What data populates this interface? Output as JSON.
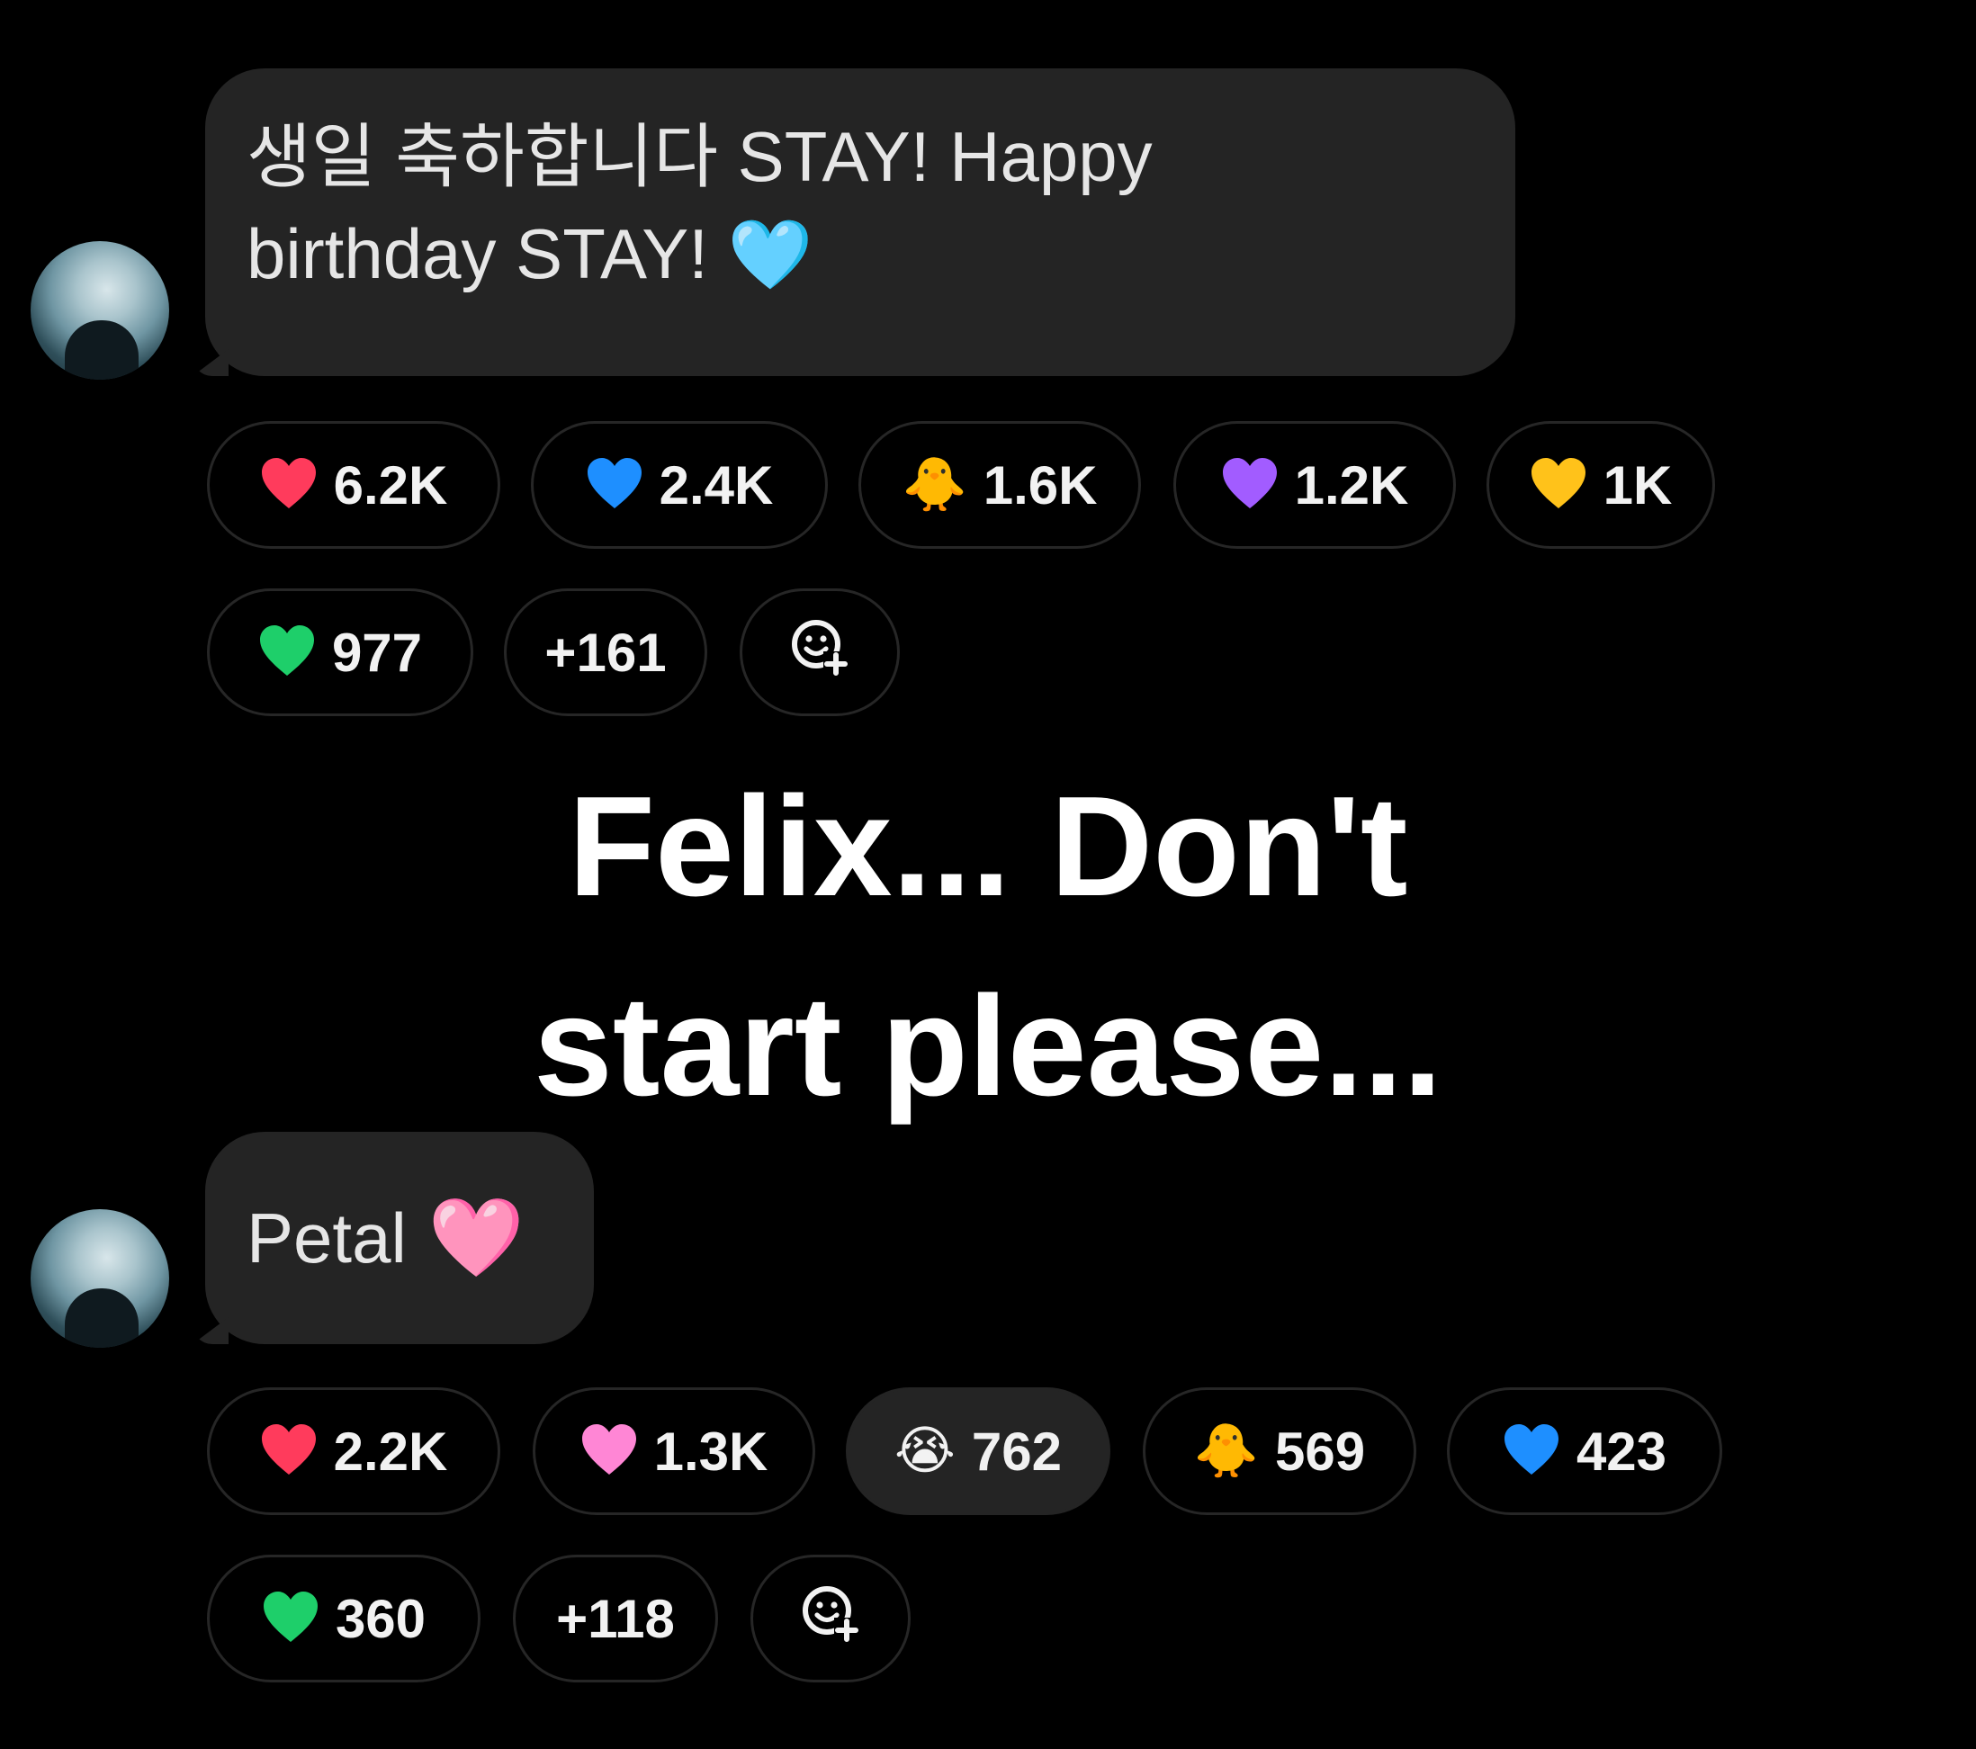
{
  "messages": [
    {
      "line1": "생일 축하합니다 STAY! Happy",
      "line2": "birthday STAY!",
      "heart_emoji": "🩵",
      "reactions": [
        {
          "icon": "red-heart-icon",
          "color": "#ff3b5c",
          "count": "6.2K"
        },
        {
          "icon": "blue-heart-icon",
          "color": "#1e8fff",
          "count": "2.4K"
        },
        {
          "icon": "chick-icon",
          "emoji": "🐥",
          "count": "1.6K"
        },
        {
          "icon": "purple-heart-icon",
          "color": "#a25cff",
          "count": "1.2K"
        },
        {
          "icon": "yellow-heart-icon",
          "color": "#ffc21a",
          "count": "1K"
        },
        {
          "icon": "green-heart-icon",
          "color": "#1ecf6a",
          "count": "977"
        },
        {
          "more": "+161"
        }
      ]
    },
    {
      "text": "Petal",
      "heart_emoji": "🩷",
      "reactions": [
        {
          "icon": "red-heart-icon",
          "color": "#ff3b5c",
          "count": "2.2K"
        },
        {
          "icon": "pink-heart-icon",
          "color": "#ff86d5",
          "count": "1.3K"
        },
        {
          "icon": "crying-face-icon",
          "emoji": "😭",
          "count": "762"
        },
        {
          "icon": "chick-icon",
          "emoji": "🐥",
          "count": "569"
        },
        {
          "icon": "blue-heart-icon",
          "color": "#1e8fff",
          "count": "423"
        },
        {
          "icon": "green-heart-icon",
          "color": "#1ecf6a",
          "count": "360"
        },
        {
          "more": "+118"
        }
      ]
    }
  ],
  "overlay": {
    "line1": "Felix... Don't",
    "line2": "start please..."
  }
}
